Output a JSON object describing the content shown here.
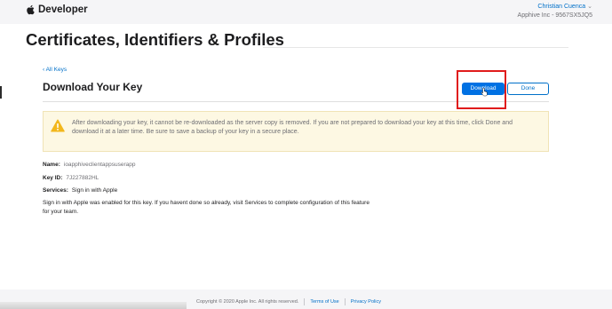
{
  "header": {
    "brand": "Developer",
    "account_name": "Christian Cuenca",
    "account_team": "Apphive Inc - 9567SX5JQ5"
  },
  "page": {
    "title": "Certificates, Identifiers & Profiles"
  },
  "section": {
    "back_link": "‹ All Keys",
    "title": "Download Your Key",
    "download_label": "Download",
    "done_label": "Done"
  },
  "warning": {
    "text": "After downloading your key, it cannot be re-downloaded as the server copy is removed. If you are not prepared to download your key at this time, click Done and download it at a later time. Be sure to save a backup of your key in a secure place."
  },
  "details": {
    "name_label": "Name:",
    "name_value": "ioapphiveclientappsuserapp",
    "key_id_label": "Key ID:",
    "key_id_value": "7J227882HL",
    "services_label": "Services:",
    "services_value": "Sign in with Apple",
    "note": "Sign in with Apple was enabled for this key. If you havent done so already, visit Services to complete configuration of this feature for your team."
  },
  "footer": {
    "copyright": "Copyright © 2020 Apple Inc. All rights reserved.",
    "terms": "Terms of Use",
    "privacy": "Privacy Policy"
  },
  "colors": {
    "accent": "#0071e3",
    "highlight_box": "#e01c1c",
    "warning_bg": "#fdf8e3",
    "warning_icon": "#f2b71d"
  }
}
